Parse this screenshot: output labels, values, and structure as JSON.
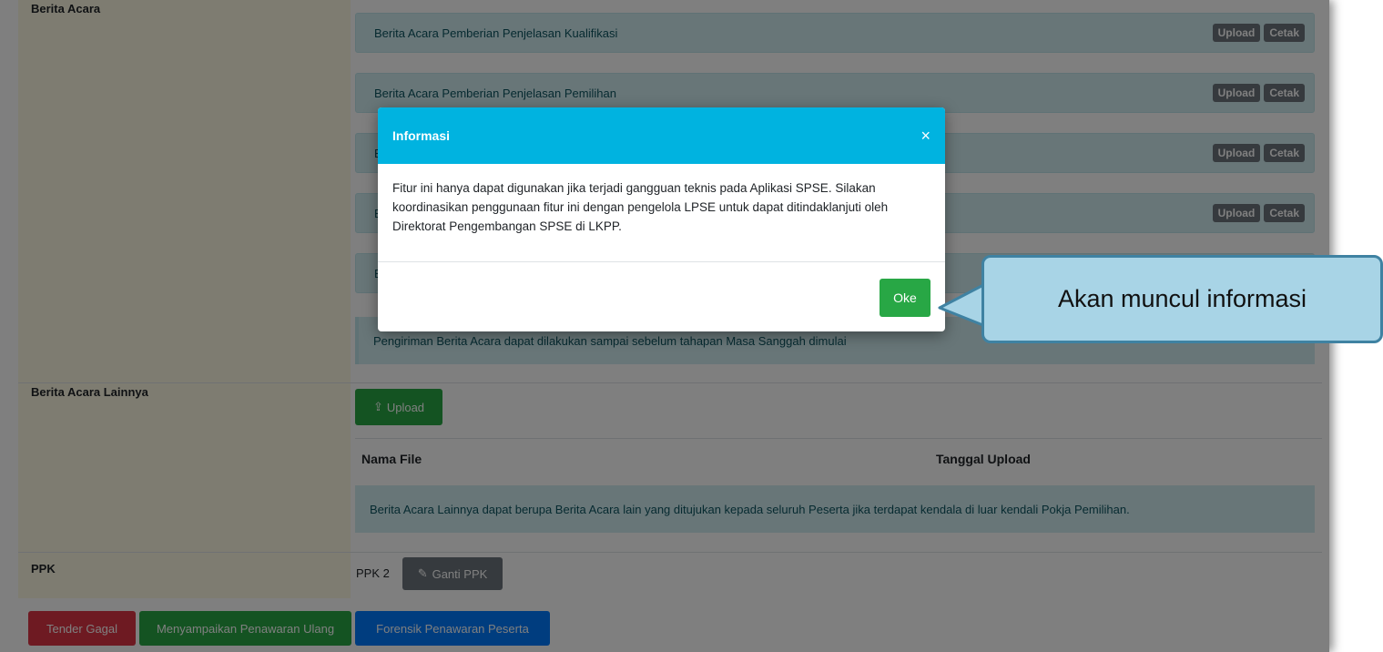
{
  "berita_acara": {
    "label": "Berita Acara",
    "items": [
      {
        "title": "Berita Acara Pemberian Penjelasan Kualifikasi",
        "upload": "Upload",
        "cetak": "Cetak"
      },
      {
        "title": "Berita Acara Pemberian Penjelasan Pemilihan",
        "upload": "Upload",
        "cetak": "Cetak"
      },
      {
        "title": "E",
        "upload": "Upload",
        "cetak": "Cetak"
      },
      {
        "title": "E",
        "upload": "Upload",
        "cetak": "Cetak"
      },
      {
        "title": "E"
      }
    ],
    "note": "Pengiriman Berita Acara dapat dilakukan sampai sebelum tahapan Masa Sanggah dimulai"
  },
  "berita_acara_lainnya": {
    "label": "Berita Acara Lainnya",
    "upload_label": "Upload",
    "col_nama_file": "Nama File",
    "col_tanggal": "Tanggal Upload",
    "note": "Berita Acara Lainnya dapat berupa Berita Acara lain yang ditujukan kepada seluruh Peserta jika terdapat kendala di luar kendali Pokja Pemilihan."
  },
  "ppk": {
    "label": "PPK",
    "value": "PPK 2",
    "ganti_label": "Ganti PPK"
  },
  "actions": {
    "tender_gagal": "Tender Gagal",
    "menyampaikan": "Menyampaikan Penawaran Ulang",
    "forensik": "Forensik Penawaran Peserta"
  },
  "modal": {
    "title": "Informasi",
    "close": "×",
    "body": "Fitur ini hanya dapat digunakan jika terjadi gangguan teknis pada Aplikasi SPSE. Silakan koordinasikan penggunaan fitur ini dengan pengelola LPSE untuk dapat ditindaklanjuti oleh Direktorat Pengembangan SPSE di LKPP.",
    "ok": "Oke"
  },
  "callout": {
    "text": "Akan muncul informasi"
  },
  "colors": {
    "modal_header": "#00b3e0",
    "success": "#28a745",
    "danger": "#dc3545",
    "primary": "#007bff",
    "callout_fill": "#a8d4e6",
    "callout_border": "#3f82a2"
  }
}
